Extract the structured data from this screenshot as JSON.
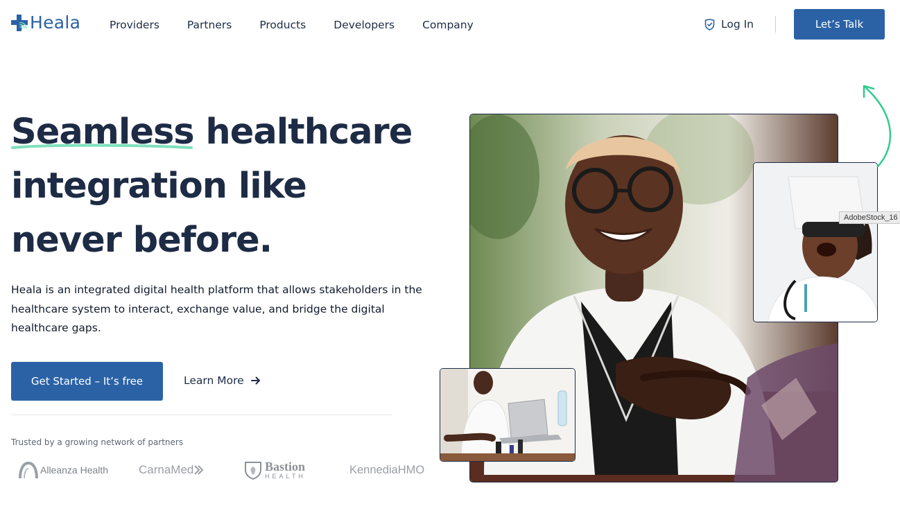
{
  "brand": {
    "name": "Heala"
  },
  "nav": {
    "items": [
      {
        "label": "Providers"
      },
      {
        "label": "Partners"
      },
      {
        "label": "Products"
      },
      {
        "label": "Developers"
      },
      {
        "label": "Company"
      }
    ],
    "login_label": "Log In",
    "cta_label": "Let’s Talk"
  },
  "hero": {
    "title_highlight": "Seamless",
    "title_rest_line1": " healthcare",
    "title_line2": "integration like",
    "title_line3": "never before.",
    "description": "Heala is an integrated digital health platform that allows stakeholders in the healthcare system to interact, exchange value, and bridge the digital healthcare gaps.",
    "primary_cta": "Get Started – It’s free",
    "secondary_cta": "Learn More"
  },
  "partners": {
    "caption": "Trusted by a growing network of partners",
    "logos": [
      {
        "name": "Alleanza Health"
      },
      {
        "name": "CarnaMed"
      },
      {
        "name": "Bastion",
        "sub": "HEALTH"
      },
      {
        "name": "KennediaHMO"
      }
    ]
  },
  "tooltip": {
    "text": "AdobeStock_16"
  },
  "colors": {
    "primary": "#2b62a6",
    "text": "#1d2b45",
    "highlight_underline": "#7ee0bd",
    "arrow": "#2ecc8f"
  }
}
